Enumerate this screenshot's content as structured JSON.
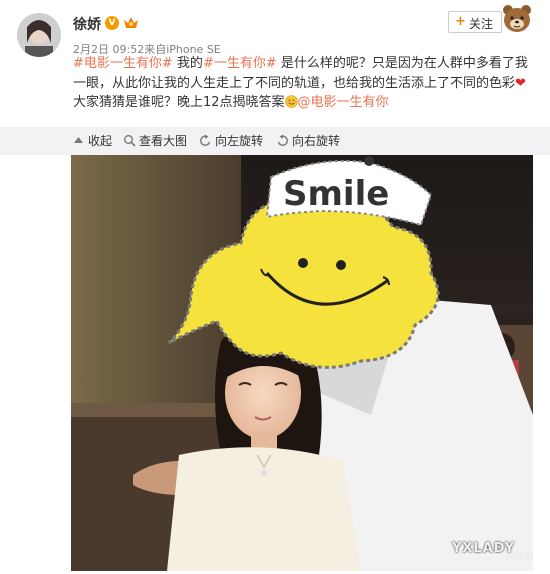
{
  "header": {
    "username": "徐娇",
    "verified_badge": "V",
    "meta": "2月2日 09:52来自iPhone SE",
    "follow_plus": "+",
    "follow_label": "关注"
  },
  "post": {
    "hashtag1": "#电影一生有你#",
    "text1": " 我的",
    "hashtag2": "#一生有你#",
    "text2": " 是什么样的呢？只是因为在人群中多看了我一眼，从此你让我的人生走上了不同的轨道，也给我的生活添上了不同的色彩",
    "text3": "大家猜猜是谁呢？晚上12点揭晓答案",
    "mention": "@电影一生有你"
  },
  "toolbar": {
    "collapse": "收起",
    "view_large": "查看大图",
    "rotate_left": "向左旋转",
    "rotate_right": "向右旋转"
  },
  "photo": {
    "sticker_text": "Smile",
    "watermark": "YXLADY",
    "watermark_user": "@徐娇"
  },
  "colors": {
    "hashtag": "#eb7350",
    "toolbar_bg": "#f2f2f5",
    "follow_plus": "#f28308",
    "verified": "#f49b00"
  }
}
